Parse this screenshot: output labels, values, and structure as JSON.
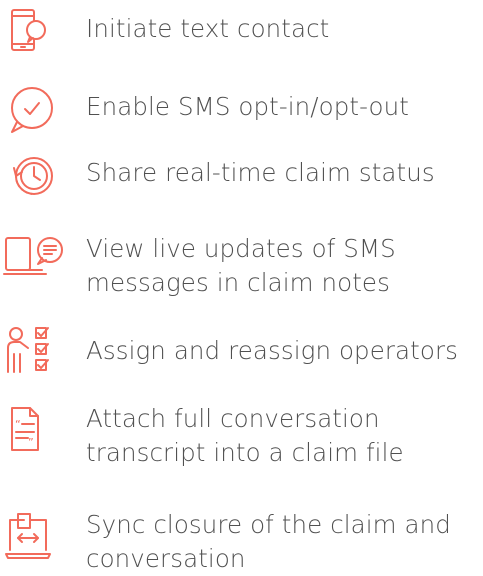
{
  "accent_color": "#f26b5b",
  "features": [
    {
      "icon": "mobile-chat-bubble-icon",
      "lines": [
        "Initiate text contact"
      ]
    },
    {
      "icon": "chat-check-icon",
      "lines": [
        "Enable SMS opt-in/opt-out"
      ]
    },
    {
      "icon": "clock-history-icon",
      "lines": [
        "Share real-time claim status"
      ]
    },
    {
      "icon": "devices-message-icon",
      "lines": [
        "View live updates of SMS",
        "messages in claim notes"
      ]
    },
    {
      "icon": "operator-checklist-icon",
      "lines": [
        "Assign and reassign operators"
      ]
    },
    {
      "icon": "document-quote-icon",
      "lines": [
        "Attach full conversation",
        "transcript into a claim file"
      ]
    },
    {
      "icon": "laptop-sync-icon",
      "lines": [
        "Sync closure of the claim and",
        "conversation"
      ]
    }
  ]
}
